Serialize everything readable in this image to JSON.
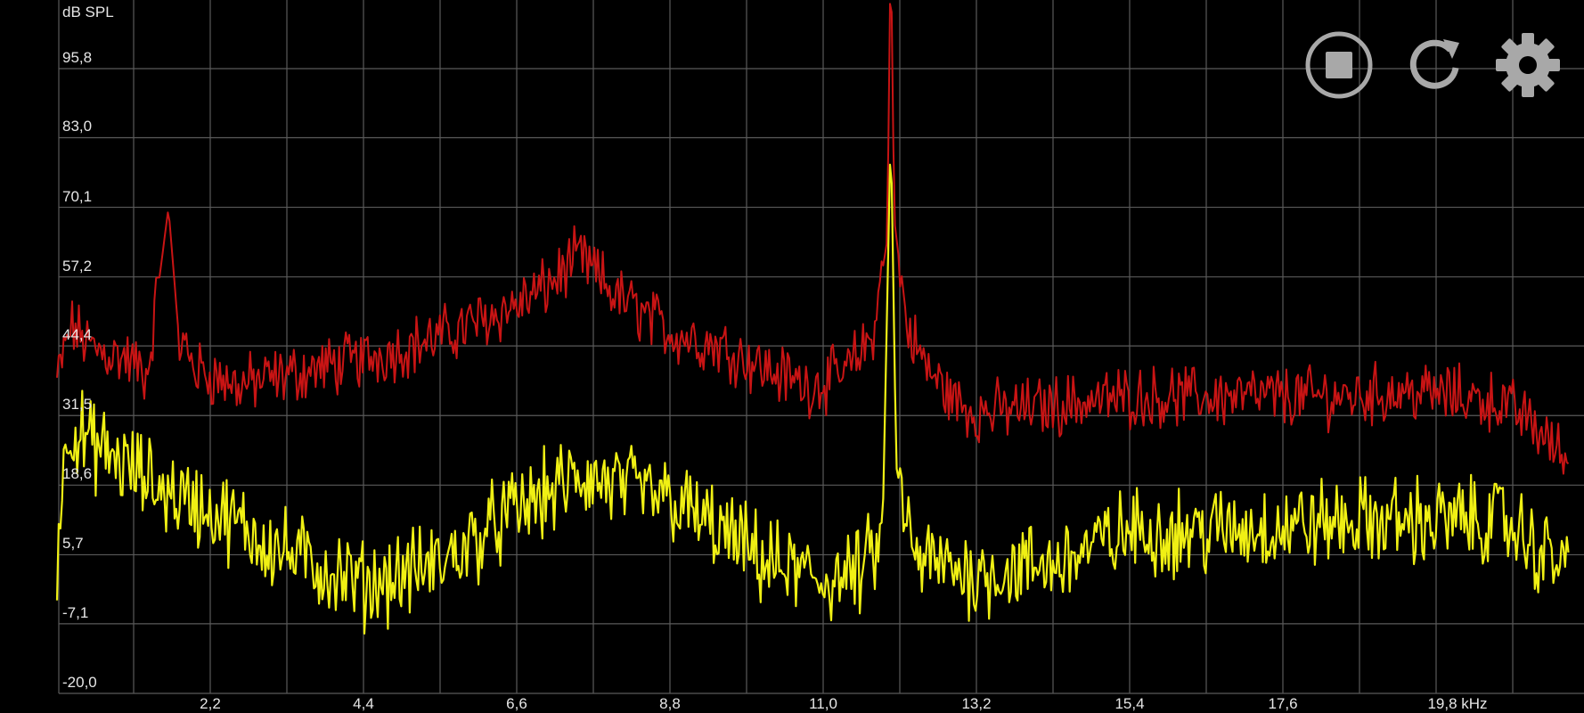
{
  "app": {
    "y_unit": "dB SPL",
    "controls": [
      {
        "name": "stop-button",
        "icon": "stop-circle-icon"
      },
      {
        "name": "reset-button",
        "icon": "refresh-icon"
      },
      {
        "name": "settings-button",
        "icon": "gear-icon"
      }
    ]
  },
  "chart_data": {
    "type": "line",
    "ylabel": "dB SPL",
    "ylim": [
      -20.0,
      108.7
    ],
    "xlim": [
      0.0,
      21.7
    ],
    "y_ticks": [
      "95,8",
      "83,0",
      "70,1",
      "57,2",
      "44,4",
      "31,5",
      "18,6",
      "5,7",
      "-7,1",
      "-20,0"
    ],
    "y_tick_values": [
      95.8,
      83.0,
      70.1,
      57.2,
      44.4,
      31.5,
      18.6,
      5.7,
      -7.1,
      -20.0
    ],
    "x_ticks": [
      "2,2",
      "4,4",
      "6,6",
      "8,8",
      "11,0",
      "13,2",
      "15,4",
      "17,6",
      "19,8 kHz"
    ],
    "x_tick_values": [
      2.2,
      4.4,
      6.6,
      8.8,
      11.0,
      13.2,
      15.4,
      17.6,
      19.8
    ],
    "grid": true,
    "series": [
      {
        "color": "#c81414",
        "x": [
          0.0,
          0.2,
          0.5,
          1.0,
          1.3,
          1.45,
          1.6,
          1.75,
          2.0,
          2.6,
          3.3,
          4.4,
          5.5,
          6.6,
          7.0,
          7.5,
          8.0,
          8.8,
          9.6,
          10.2,
          10.8,
          11.3,
          11.7,
          11.92,
          11.97,
          12.02,
          12.2,
          12.5,
          12.9,
          13.2,
          14.0,
          15.4,
          16.5,
          17.6,
          18.5,
          19.4,
          20.2,
          20.7,
          21.1,
          21.7
        ],
        "values": [
          38,
          48,
          44,
          42,
          39,
          55,
          70,
          46,
          40,
          37,
          39,
          42,
          46,
          52,
          55,
          61,
          54,
          47,
          44,
          40,
          37,
          39,
          46,
          64,
          120,
          68,
          48,
          40,
          34,
          32,
          33,
          35,
          35,
          35,
          35,
          36,
          35,
          34,
          31,
          23
        ]
      },
      {
        "color": "#f0f014",
        "x": [
          0.0,
          0.15,
          0.5,
          1.0,
          1.5,
          2.2,
          3.3,
          4.4,
          5.5,
          6.6,
          7.5,
          8.8,
          9.5,
          10.2,
          11.0,
          11.5,
          11.85,
          11.97,
          12.05,
          12.3,
          13.2,
          14.3,
          15.4,
          16.5,
          17.6,
          18.7,
          19.8,
          20.8,
          21.3,
          21.7
        ],
        "values": [
          5,
          30,
          26,
          22,
          18,
          14,
          6,
          0,
          4,
          14,
          20,
          16,
          10,
          4,
          1,
          2,
          8,
          85,
          22,
          5,
          2,
          4,
          10,
          10,
          11,
          12,
          12,
          12,
          6,
          4
        ]
      }
    ]
  }
}
